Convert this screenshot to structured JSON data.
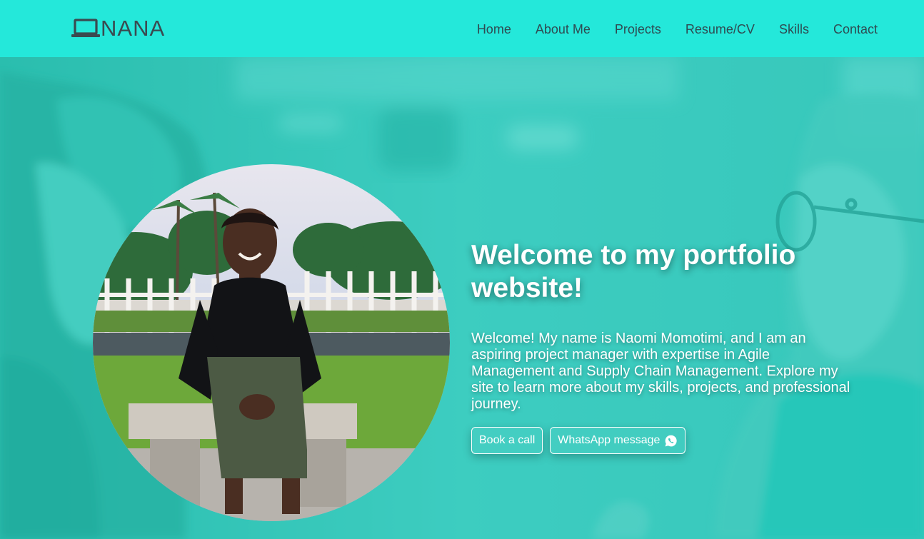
{
  "brand": {
    "logo_text": "NANA"
  },
  "nav": {
    "items": [
      {
        "label": "Home"
      },
      {
        "label": "About Me"
      },
      {
        "label": "Projects"
      },
      {
        "label": "Resume/CV"
      },
      {
        "label": "Skills"
      },
      {
        "label": "Contact"
      }
    ]
  },
  "hero": {
    "title": "Welcome to my portfolio website!",
    "description": "Welcome! My name is Naomi Momotimi, and I am an aspiring project manager with expertise in Agile Management and Supply Chain Management. Explore my site to learn more about my skills, projects, and professional journey.",
    "buttons": {
      "book_call": "Book a call",
      "whatsapp": "WhatsApp message"
    }
  },
  "icons": {
    "logo": "laptop-icon",
    "whatsapp": "whatsapp-icon"
  },
  "colors": {
    "navbar_bg": "#24e8da",
    "hero_tint": "#3cc9bd",
    "nav_text": "#2f4b52",
    "hero_text": "#ffffff"
  }
}
